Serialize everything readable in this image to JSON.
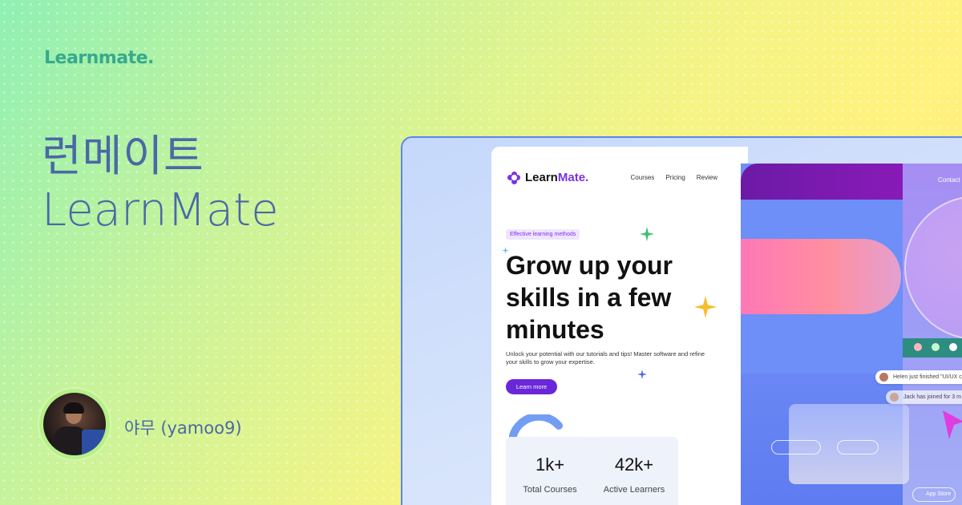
{
  "brand": {
    "logo": "Learnmate."
  },
  "title": {
    "ko": "런메이트",
    "en": "LearnMate"
  },
  "author": {
    "name": "야무 (yamoo9)"
  },
  "mockup": {
    "logo_main": "Learn",
    "logo_accent": "Mate.",
    "nav": [
      "Courses",
      "Pricing",
      "Review"
    ],
    "badge": "Effective learning methods",
    "hero_lines": [
      "Grow up your",
      "skills in a few",
      "minutes"
    ],
    "subtitle": "Unlock your potential with our tutorials and tips! Master software and refine your skills to grow your expertise.",
    "cta": "Learn more",
    "stats": [
      {
        "value": "1k+",
        "label": "Total Courses"
      },
      {
        "value": "42k+",
        "label": "Active Learners"
      }
    ],
    "contact": "Contact l",
    "notifications": [
      "Helen just finished \"UI/UX c",
      "Jack has joined for 3 m"
    ],
    "app_store": "App Store"
  },
  "colors": {
    "accent": "#7a33e6",
    "brand_text": "#38a98d",
    "title_text": "#4a68a6",
    "frame_border": "#5c86e8"
  }
}
